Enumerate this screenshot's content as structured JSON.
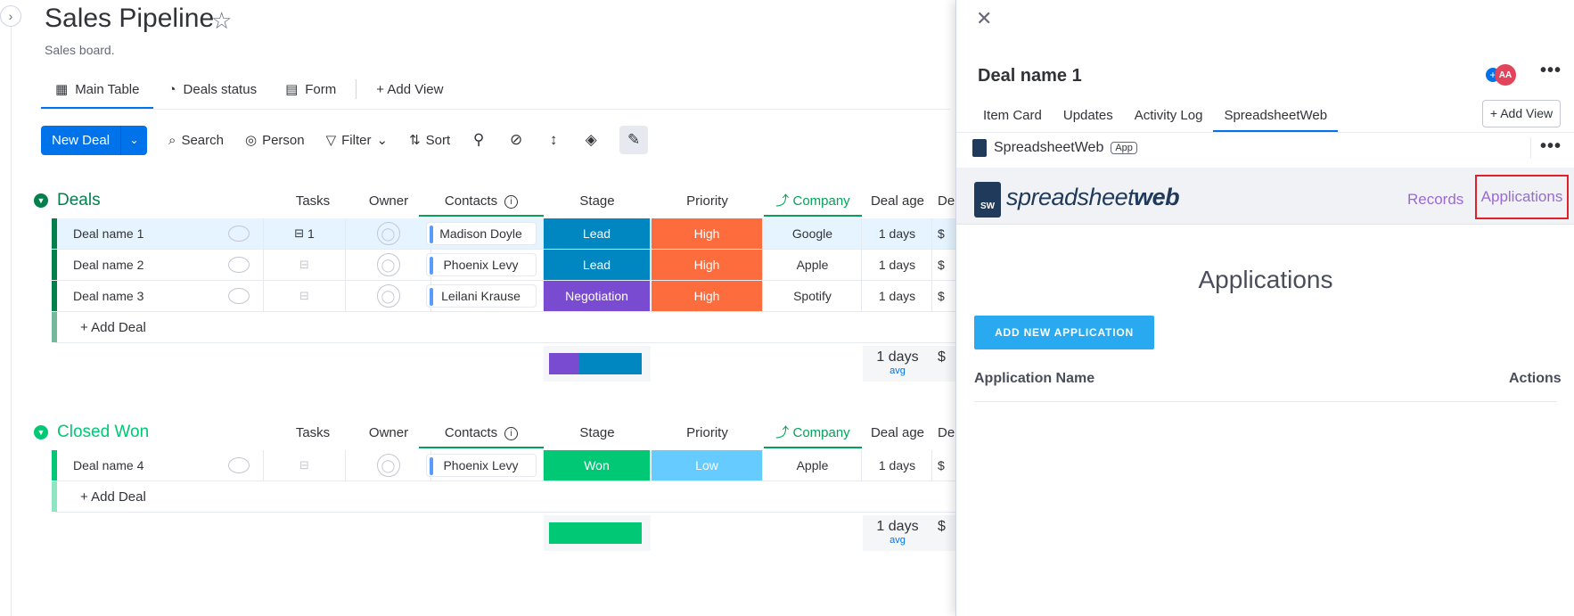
{
  "board": {
    "title": "Sales Pipeline",
    "description": "Sales board.",
    "views": [
      {
        "label": "Main Table",
        "icon": "table-icon"
      },
      {
        "label": "Deals status",
        "icon": "pie-chart-icon"
      },
      {
        "label": "Form",
        "icon": "form-icon"
      }
    ],
    "add_view": "+ Add View"
  },
  "toolbar": {
    "new_item": "New Deal",
    "search": "Search",
    "person": "Person",
    "filter": "Filter",
    "sort": "Sort"
  },
  "columns": {
    "tasks": "Tasks",
    "owner": "Owner",
    "contacts": "Contacts",
    "stage": "Stage",
    "priority": "Priority",
    "company": "Company",
    "deal_age": "Deal age",
    "truncated": "De"
  },
  "groups": [
    {
      "title": "Deals",
      "color": "#037f4c",
      "rows": [
        {
          "name": "Deal name 1",
          "tasks": "1",
          "contact": "Madison Doyle",
          "stage": "Lead",
          "stage_color": "#0086c0",
          "priority": "High",
          "priority_color": "#fd6c3c",
          "company": "Google",
          "age": "1 days",
          "cut": "$"
        },
        {
          "name": "Deal name 2",
          "tasks": "",
          "contact": "Phoenix Levy",
          "stage": "Lead",
          "stage_color": "#0086c0",
          "priority": "High",
          "priority_color": "#fd6c3c",
          "company": "Apple",
          "age": "1 days",
          "cut": "$"
        },
        {
          "name": "Deal name 3",
          "tasks": "",
          "contact": "Leilani Krause",
          "stage": "Negotiation",
          "stage_color": "#784bd1",
          "priority": "High",
          "priority_color": "#fd6c3c",
          "company": "Spotify",
          "age": "1 days",
          "cut": "$"
        }
      ],
      "add_label": "+ Add Deal",
      "summary_age": "1 days",
      "summary_avg": "avg",
      "summary_cut": "$"
    },
    {
      "title": "Closed Won",
      "color": "#00c875",
      "rows": [
        {
          "name": "Deal name 4",
          "tasks": "",
          "contact": "Phoenix Levy",
          "stage": "Won",
          "stage_color": "#00c875",
          "priority": "Low",
          "priority_color": "#66ccff",
          "company": "Apple",
          "age": "1 days",
          "cut": "$"
        }
      ],
      "add_label": "+ Add Deal",
      "summary_age": "1 days",
      "summary_avg": "avg",
      "summary_cut": "$"
    }
  ],
  "panel": {
    "title": "Deal name 1",
    "avatar_initials": "AA",
    "tabs": [
      "Item Card",
      "Updates",
      "Activity Log",
      "SpreadsheetWeb"
    ],
    "add_view": "+ Add View",
    "app_name": "SpreadsheetWeb",
    "app_badge": "App",
    "logo_light": "spreadsheet",
    "logo_bold": "web",
    "logo_mark": "SW",
    "nav_records": "Records",
    "nav_applications": "Applications",
    "heading": "Applications",
    "add_button": "ADD NEW APPLICATION",
    "col_name": "Application Name",
    "col_actions": "Actions"
  }
}
